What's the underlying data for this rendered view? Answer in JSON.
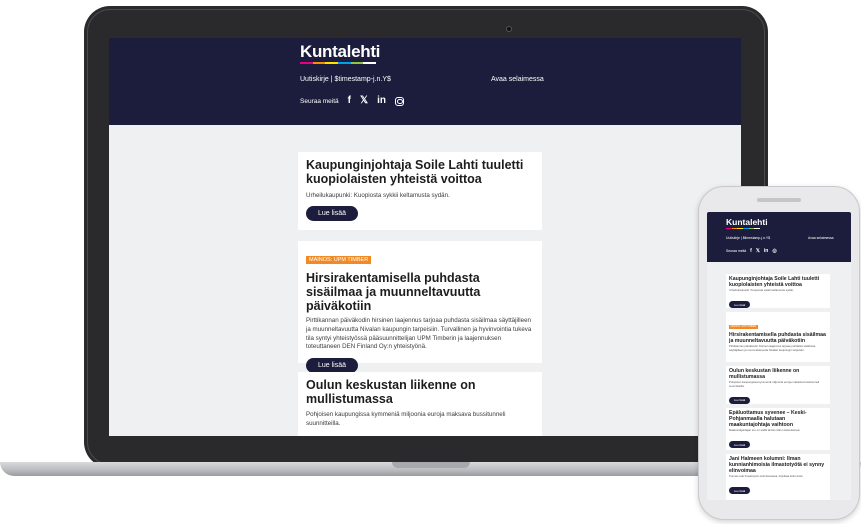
{
  "brand": {
    "name": "Kuntalehti",
    "stripe_colors": [
      "#e6007e",
      "#f39200",
      "#ffde00",
      "#00a0e3",
      "#8dc63f",
      "#ffffff"
    ],
    "header_bg": "#1c1c3c",
    "button_bg": "#1c1c3c",
    "sponsor_tag_bg": "#f08a24"
  },
  "header": {
    "meta": "Uutiskirje | $timestamp-j.n.Y$",
    "browser_link": "Avaa selaimessa",
    "follow_label": "Seuraa meitä",
    "social_icons": [
      "facebook-icon",
      "x-icon",
      "linkedin-icon",
      "instagram-icon"
    ],
    "social_glyphs": {
      "facebook": "f",
      "x": "𝕏",
      "linkedin": "in"
    }
  },
  "articles": [
    {
      "title": "Kaupunginjohtaja Soile Lahti tuuletti kuopiolaisten yhteistä voittoa",
      "summary": "Urheilukaupunki: Kuopiosta sykkii keltamusta sydän.",
      "button": "Lue lisää"
    },
    {
      "tag": "MAINOS: UPM TIMBER",
      "title": "Hirsirakentamisella puhdasta sisäilmaa ja muunneltavuutta päiväkotiin",
      "summary": "Pirttikannan päiväkodin hirsinen laajennus tarjoaa puhdasta sisäilmaa säyttäjilleen ja muunneltavuutta Nivalan kaupungin tarpeisiin. Turvallinen ja hyvinvointia tukeva tila syntyi yhteistyössä pääsuunnittelijan UPM Timberin ja laajennuksen toteuttaneen DEN Finland Oy:n yhteistyönä.",
      "button": "Lue lisää"
    },
    {
      "title": "Oulun keskustan liikenne on mullistumassa",
      "summary": "Pohjoisen kaupungissa kymmeniä miljoonia euroja maksava bussitunneli suunnitteilla."
    }
  ],
  "phone_articles": [
    {
      "title": "Kaupunginjohtaja Soile Lahti tuuletti kuopiolaisten yhteistä voittoa",
      "summary": "Urheilukaupunki: Kuopiosta sykkii keltamusta sydän.",
      "button": "Lue lisää"
    },
    {
      "tag": "MAINOS: UPM TIMBER",
      "title": "Hirsirakentamisella puhdasta sisäilmaa ja muunneltavuutta päiväkotiin",
      "summary": "Pirttikannan päiväkodin hirsinen laajennus tarjoaa puhdasta sisäilmaa säyttäjilleen ja muunneltavuutta Nivalan kaupungin tarpeisiin.",
      "button": "Lue lisää"
    },
    {
      "title": "Oulun keskustan liikenne on mullistumassa",
      "summary": "Pohjoisen kaupungissa kymmeniä miljoonia euroja maksava bussitunneli suunnitteilla.",
      "button": "Lue lisää"
    },
    {
      "title": "Epäluottamus syvenee – Keski-Pohjanmaalla halutaan maakuntajohtaja vaihtoon",
      "summary": "Maakuntajohtajan ero on esillä tämän viikon kokouksissa.",
      "button": "Lue lisää"
    },
    {
      "title": "Jani Halmeen kolumni: Ilman kunnianhimoisia ilmastotyötä ei synny elinvoimaa",
      "summary": "Kunnat ovat ilmastotyön eturintamassa, kirjoittaa kolumnisti.",
      "button": "Lue lisää"
    }
  ]
}
